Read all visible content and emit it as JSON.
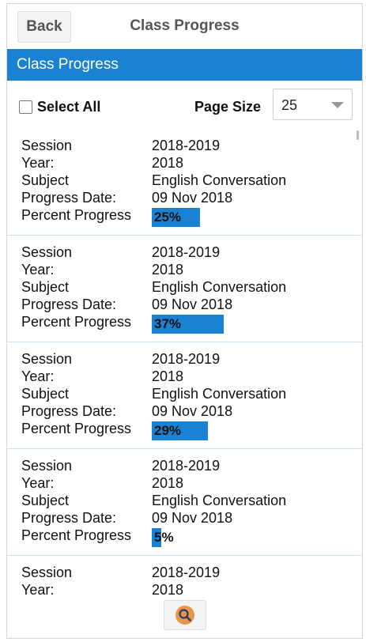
{
  "topbar": {
    "back_label": "Back",
    "title": "Class Progress"
  },
  "header": {
    "title": "Class Progress"
  },
  "controls": {
    "select_all_label": "Select All",
    "page_size_label": "Page Size",
    "page_size_value": "25"
  },
  "labels": {
    "session": "Session",
    "year": "Year:",
    "subject": "Subject",
    "progress_date": "Progress Date:",
    "percent_progress": "Percent Progress"
  },
  "records": [
    {
      "session": "2018-2019",
      "year": "2018",
      "subject": "English Conversation",
      "progress_date": "09 Nov 2018",
      "percent_label": "25%",
      "percent": 25
    },
    {
      "session": "2018-2019",
      "year": "2018",
      "subject": "English Conversation",
      "progress_date": "09 Nov 2018",
      "percent_label": "37%",
      "percent": 37
    },
    {
      "session": "2018-2019",
      "year": "2018",
      "subject": "English Conversation",
      "progress_date": "09 Nov 2018",
      "percent_label": "29%",
      "percent": 29
    },
    {
      "session": "2018-2019",
      "year": "2018",
      "subject": "English Conversation",
      "progress_date": "09 Nov 2018",
      "percent_label": "5%",
      "percent": 5
    },
    {
      "session": "2018-2019",
      "year": "2018"
    }
  ],
  "colors": {
    "accent": "#1a82d3",
    "search_icon": "#e8954a"
  },
  "icons": {
    "search": "search-icon",
    "dropdown": "chevron-down-icon"
  }
}
